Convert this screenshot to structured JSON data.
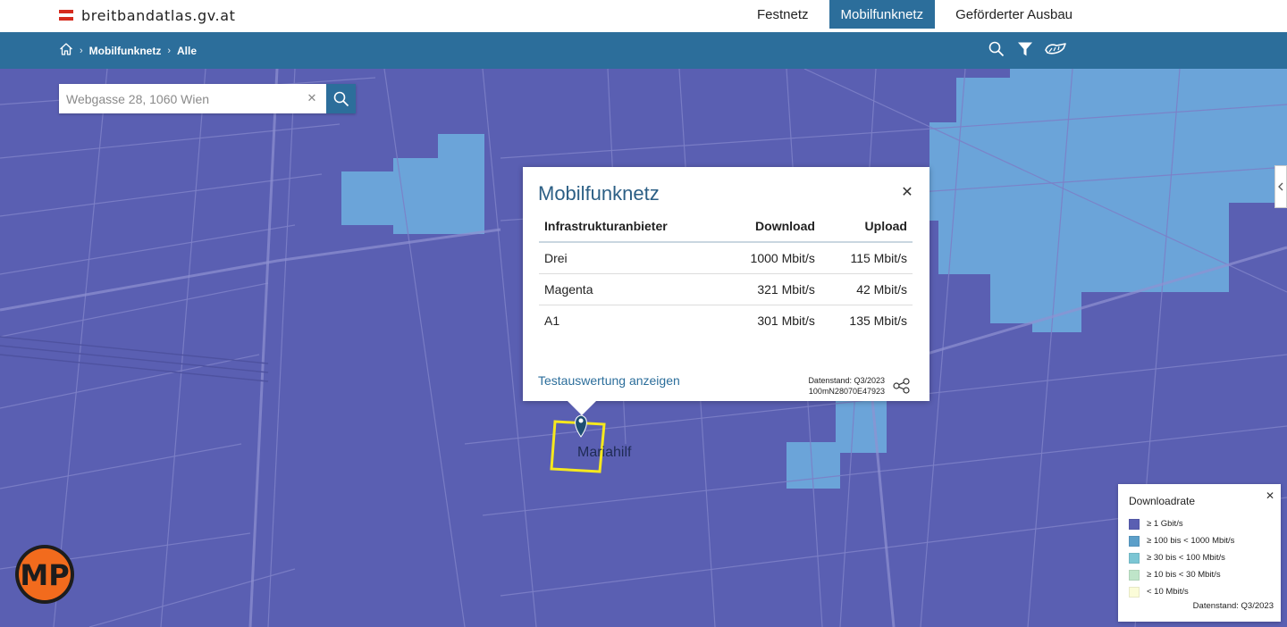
{
  "brand": {
    "name": "breitbandatlas.gv.at"
  },
  "nav": {
    "tabs": [
      {
        "label": "Festnetz",
        "active": false
      },
      {
        "label": "Mobilfunknetz",
        "active": true
      },
      {
        "label": "Geförderter Ausbau",
        "active": false
      }
    ]
  },
  "breadcrumb": {
    "items": [
      "Mobilfunknetz",
      "Alle"
    ]
  },
  "tools": {
    "icons": [
      "search-icon",
      "filter-icon",
      "measure-icon"
    ]
  },
  "search": {
    "placeholder": "Webgasse 28, 1060 Wien",
    "value": ""
  },
  "map": {
    "place_label": "Mariahilf"
  },
  "popup": {
    "title": "Mobilfunknetz",
    "columns": [
      "Infrastrukturanbieter",
      "Download",
      "Upload"
    ],
    "rows": [
      {
        "provider": "Drei",
        "download": "1000 Mbit/s",
        "upload": "115 Mbit/s"
      },
      {
        "provider": "Magenta",
        "download": "321 Mbit/s",
        "upload": "42 Mbit/s"
      },
      {
        "provider": "A1",
        "download": "301 Mbit/s",
        "upload": "135 Mbit/s"
      }
    ],
    "link": "Testauswertung anzeigen",
    "datenstand": "Datenstand: Q3/2023",
    "cell_id": "100mN28070E47923"
  },
  "legend": {
    "title": "Downloadrate",
    "items": [
      {
        "label": "≥ 1 Gbit/s",
        "color": "#5a5fb2"
      },
      {
        "label": "≥ 100 bis < 1000 Mbit/s",
        "color": "#5c9fc9"
      },
      {
        "label": "≥ 30 bis < 100 Mbit/s",
        "color": "#7cc6d4"
      },
      {
        "label": "≥ 10 bis < 30 Mbit/s",
        "color": "#bfe5c9"
      },
      {
        "label": "< 10 Mbit/s",
        "color": "#fbfcd8"
      }
    ],
    "datenstand": "Datenstand: Q3/2023"
  },
  "colors": {
    "primary": "#2c6e9b",
    "map_high": "#5a5fb2",
    "map_mid": "#6fb0df",
    "highlight": "#f5e81e"
  },
  "logo": {
    "text": "MP"
  }
}
